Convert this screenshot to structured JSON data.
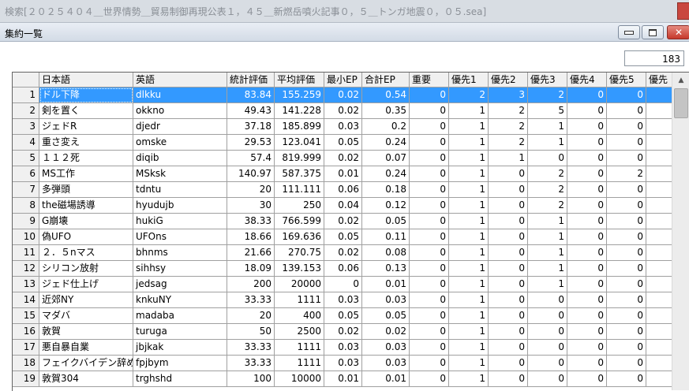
{
  "outer_window": {
    "title": "検索[２０２５４０４＿世界情勢＿貿易制御再現公表１，４５＿新燃岳噴火記事０，５＿トンガ地震０，０５.sea]"
  },
  "window": {
    "title": "集約一覧",
    "close_glyph": "✕"
  },
  "record_count": "183",
  "scroll_up_glyph": "▲",
  "table": {
    "columns": [
      "日本語",
      "英語",
      "統計評価",
      "平均評価",
      "最小EP",
      "合計EP",
      "重要",
      "優先1",
      "優先2",
      "優先3",
      "優先4",
      "優先5",
      "優先"
    ],
    "selected_row": 1,
    "rows": [
      [
        "1",
        "ドル下降",
        "dlkku",
        "83.84",
        "155.259",
        "0.02",
        "0.54",
        "0",
        "2",
        "3",
        "2",
        "0",
        "0"
      ],
      [
        "2",
        "剣を置く",
        "okkno",
        "49.43",
        "141.228",
        "0.02",
        "0.35",
        "0",
        "1",
        "2",
        "5",
        "0",
        "0"
      ],
      [
        "3",
        "ジェドR",
        "djedr",
        "37.18",
        "185.899",
        "0.03",
        "0.2",
        "0",
        "1",
        "2",
        "1",
        "0",
        "0"
      ],
      [
        "4",
        "重さ変え",
        "omske",
        "29.53",
        "123.041",
        "0.05",
        "0.24",
        "0",
        "1",
        "2",
        "1",
        "0",
        "0"
      ],
      [
        "5",
        "１１２死",
        "diqib",
        "57.4",
        "819.999",
        "0.02",
        "0.07",
        "0",
        "1",
        "1",
        "0",
        "0",
        "0"
      ],
      [
        "6",
        "MS工作",
        "MSksk",
        "140.97",
        "587.375",
        "0.01",
        "0.24",
        "0",
        "1",
        "0",
        "2",
        "0",
        "2"
      ],
      [
        "7",
        "多弾頭",
        "tdntu",
        "20",
        "111.111",
        "0.06",
        "0.18",
        "0",
        "1",
        "0",
        "2",
        "0",
        "0"
      ],
      [
        "8",
        "the磁場誘導",
        "hyudujb",
        "30",
        "250",
        "0.04",
        "0.12",
        "0",
        "1",
        "0",
        "2",
        "0",
        "0"
      ],
      [
        "9",
        "G崩壊",
        "hukiG",
        "38.33",
        "766.599",
        "0.02",
        "0.05",
        "0",
        "1",
        "0",
        "1",
        "0",
        "0"
      ],
      [
        "10",
        "偽UFO",
        "UFOns",
        "18.66",
        "169.636",
        "0.05",
        "0.11",
        "0",
        "1",
        "0",
        "1",
        "0",
        "0"
      ],
      [
        "11",
        "２．５nマス",
        "bhnms",
        "21.66",
        "270.75",
        "0.02",
        "0.08",
        "0",
        "1",
        "0",
        "1",
        "0",
        "0"
      ],
      [
        "12",
        "シリコン放射",
        "sihhsy",
        "18.09",
        "139.153",
        "0.06",
        "0.13",
        "0",
        "1",
        "0",
        "1",
        "0",
        "0"
      ],
      [
        "13",
        "ジェド仕上げ",
        "jedsag",
        "200",
        "20000",
        "0",
        "0.01",
        "0",
        "1",
        "0",
        "1",
        "0",
        "0"
      ],
      [
        "14",
        "近郊NY",
        "knkuNY",
        "33.33",
        "1111",
        "0.03",
        "0.03",
        "0",
        "1",
        "0",
        "0",
        "0",
        "0"
      ],
      [
        "15",
        "マダバ",
        "madaba",
        "20",
        "400",
        "0.05",
        "0.05",
        "0",
        "1",
        "0",
        "0",
        "0",
        "0"
      ],
      [
        "16",
        "敦賀",
        "turuga",
        "50",
        "2500",
        "0.02",
        "0.02",
        "0",
        "1",
        "0",
        "0",
        "0",
        "0"
      ],
      [
        "17",
        "悪自暴自業",
        "jbjkak",
        "33.33",
        "1111",
        "0.03",
        "0.03",
        "0",
        "1",
        "0",
        "0",
        "0",
        "0"
      ],
      [
        "18",
        "フェイクバイデン辞め",
        "fpjbym",
        "33.33",
        "1111",
        "0.03",
        "0.03",
        "0",
        "1",
        "0",
        "0",
        "0",
        "0"
      ],
      [
        "19",
        "敦賀304",
        "trghshd",
        "100",
        "10000",
        "0.01",
        "0.01",
        "0",
        "1",
        "0",
        "0",
        "0",
        "0"
      ]
    ]
  }
}
